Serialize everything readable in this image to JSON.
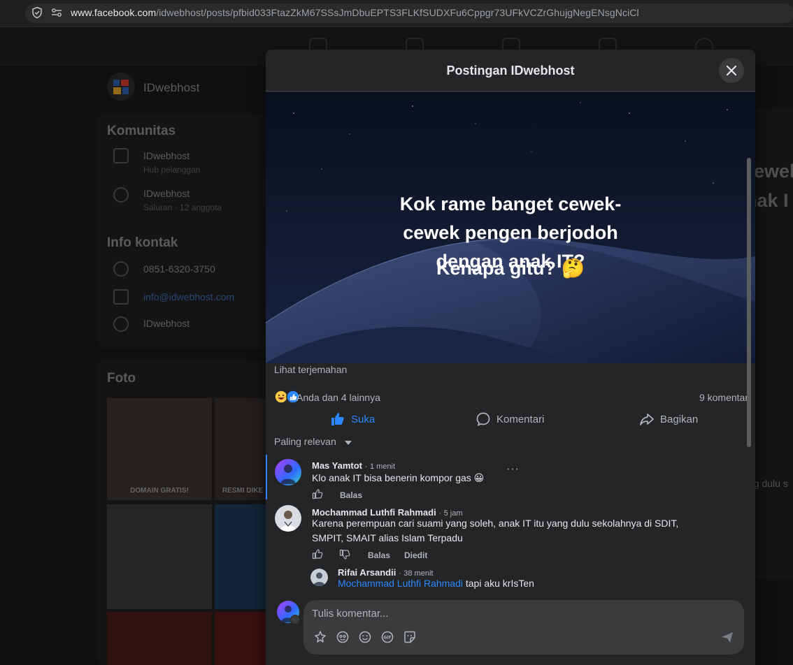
{
  "browser": {
    "url_host": "www.facebook.com",
    "url_path": "/idwebhost/posts/pfbid033FtazZkM67SSsJmDbuEPTS3FLKfSUDXFu6Cppgr73UFkVCZrGhujgNegENsgNciCl"
  },
  "background": {
    "page_name": "IDwebhost",
    "community_heading": "Komunitas",
    "communities": [
      {
        "name": "IDwebhost",
        "sub": "Hub pelanggan"
      },
      {
        "name": "IDwebhost",
        "sub": "Saluran · 12 anggota"
      }
    ],
    "contact_heading": "Info kontak",
    "phone": "0851-6320-3750",
    "email": "info@idwebhost.com",
    "messenger": "IDwebhost",
    "photos_heading": "Foto",
    "photo_captions": [
      "DOMAIN GRATIS!",
      "RESMI DIKE"
    ],
    "right_partial": [
      "ewek",
      "nak I"
    ],
    "right_partial_small": "ng dulu s"
  },
  "modal": {
    "title": "Postingan IDwebhost",
    "post_headline": "Kok rame banget cewek-cewek pengen berjodoh dengan anak IT?",
    "post_subline": "Kenapa gitu? 🤔",
    "see_translation": "Lihat terjemahan",
    "reaction_summary": "Anda dan 4 lainnya",
    "comment_count": "9 komentar",
    "actions": {
      "like": "Suka",
      "comment": "Komentari",
      "share": "Bagikan"
    },
    "sort_label": "Paling relevan",
    "comments": [
      {
        "author": "Mas Yamtot",
        "time": "1 menit",
        "text": "Klo anak IT bisa benerin kompor gas 😀",
        "reply": "Balas"
      },
      {
        "author": "Mochammad Luthfi Rahmadi",
        "time": "5 jam",
        "text": "Karena perempuan cari suami yang soleh, anak IT itu yang dulu sekolahnya di SDIT, SMPIT, SMAIT alias Islam Terpadu",
        "reply": "Balas",
        "edited": "Diedit"
      },
      {
        "author": "Rifai Arsandii",
        "time": "38 menit",
        "mention": "Mochammad Luthfi Rahmadi",
        "text": "tapi aku krIsTen"
      }
    ],
    "composer_placeholder": "Tulis komentar..."
  },
  "colors": {
    "accent": "#2d88ff",
    "modal_bg": "#242526",
    "input_bg": "#3a3b3c"
  }
}
